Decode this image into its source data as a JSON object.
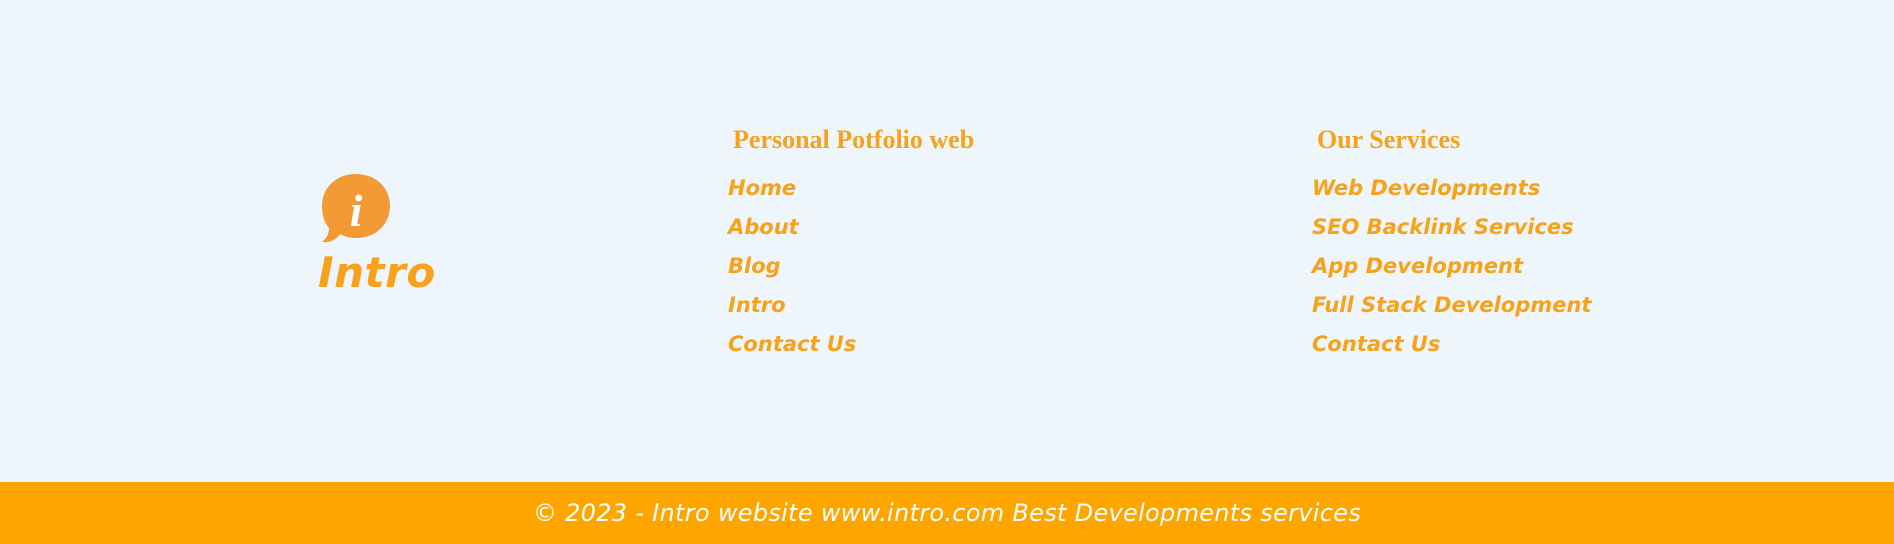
{
  "brand": {
    "icon": "info-speech-bubble-icon",
    "glyph": "i",
    "name": "Intro",
    "color": "#f7a21a"
  },
  "columns": [
    {
      "title": "Personal Potfolio web",
      "links": [
        "Home",
        "About",
        "Blog",
        "Intro",
        "Contact Us"
      ]
    },
    {
      "title": "Our Services",
      "links": [
        "Web Developments",
        "SEO Backlink Services",
        "App Development",
        "Full Stack Development",
        "Contact Us"
      ]
    }
  ],
  "copyright": {
    "text": "© 2023 - Intro website www.intro.com Best Developments services",
    "bar_color": "#ffa500"
  }
}
